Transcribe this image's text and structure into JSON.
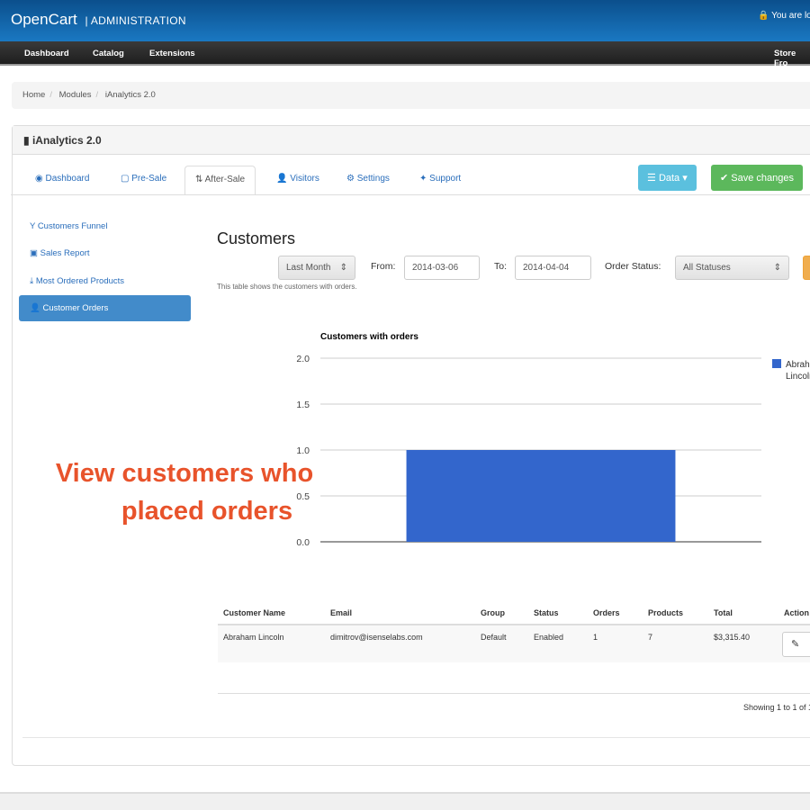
{
  "header": {
    "brand": "OpenCart",
    "brand_sub": "ADMINISTRATION",
    "login_text": "You are lo",
    "lock_icon": "lock-icon"
  },
  "nav": {
    "items": [
      "Dashboard",
      "Catalog",
      "Extensions"
    ],
    "right": "Store Fro"
  },
  "breadcrumb": [
    "Home",
    "Modules",
    "iAnalytics 2.0"
  ],
  "panel": {
    "title": "iAnalytics 2.0"
  },
  "tabs": [
    {
      "label": "Dashboard",
      "icon": "dashboard-icon"
    },
    {
      "label": "Pre-Sale",
      "icon": "cart-icon"
    },
    {
      "label": "After-Sale",
      "icon": "sort-icon"
    },
    {
      "label": "Visitors",
      "icon": "user-icon"
    },
    {
      "label": "Settings",
      "icon": "cogs-icon"
    },
    {
      "label": "Support",
      "icon": "pushpin-icon"
    }
  ],
  "active_tab": "After-Sale",
  "buttons": {
    "data": "Data",
    "save": "Save changes",
    "colors": {
      "data": "#5bc0de",
      "save": "#5cb85c"
    }
  },
  "sidebar": [
    {
      "label": "Customers Funnel",
      "icon": "filter-icon"
    },
    {
      "label": "Sales Report",
      "icon": "money-icon"
    },
    {
      "label": "Most Ordered Products",
      "icon": "download-icon"
    },
    {
      "label": "Customer Orders",
      "icon": "user-icon",
      "active": true
    }
  ],
  "main": {
    "title": "Customers",
    "range": "Last Month",
    "from_label": "From:",
    "from": "2014-03-06",
    "to_label": "To:",
    "to": "2014-04-04",
    "status_label": "Order Status:",
    "status": "All Statuses",
    "hint": "This table shows the customers with orders."
  },
  "promo": {
    "line1": "View customers who",
    "line2": "placed orders"
  },
  "chart_data": {
    "type": "bar",
    "title": "Customers with orders",
    "categories": [
      ""
    ],
    "series": [
      {
        "name": "Abraham Lincoln",
        "values": [
          1
        ]
      }
    ],
    "ylim": [
      0,
      2
    ],
    "yticks": [
      "0.0",
      "0.5",
      "1.0",
      "1.5",
      "2.0"
    ],
    "grid": true,
    "legend": "right",
    "color": "#3366cc"
  },
  "table": {
    "headers": [
      "Customer Name",
      "Email",
      "Group",
      "Status",
      "Orders",
      "Products",
      "Total",
      "Action"
    ],
    "rows": [
      [
        "Abraham Lincoln",
        "dimitrov@isenselabs.com",
        "Default",
        "Enabled",
        "1",
        "7",
        "$3,315.40"
      ]
    ]
  },
  "pagination": "Showing 1 to 1 of 1"
}
